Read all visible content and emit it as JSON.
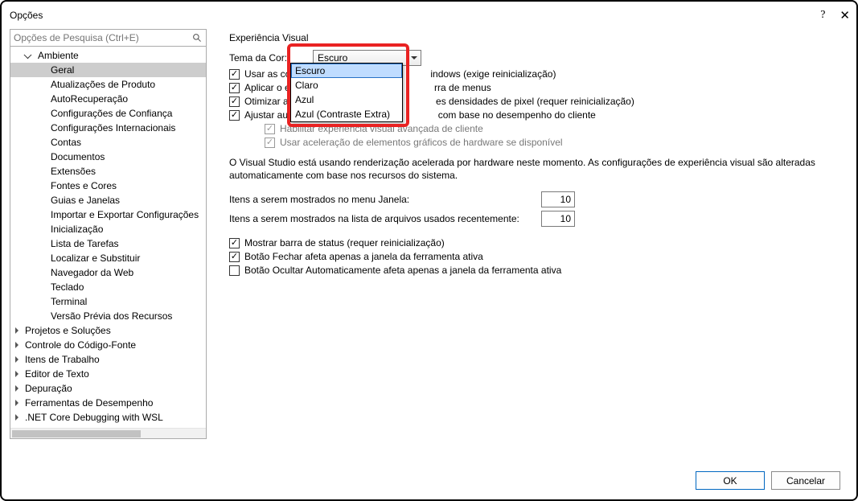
{
  "window": {
    "title": "Opções"
  },
  "search": {
    "placeholder": "Opções de Pesquisa (Ctrl+E)"
  },
  "tree": {
    "ambiente": "Ambiente",
    "geral": "Geral",
    "atualizacoes": "Atualizações de Produto",
    "autorecup": "AutoRecuperação",
    "confianca": "Configurações de Confiança",
    "internacionais": "Configurações Internacionais",
    "contas": "Contas",
    "documentos": "Documentos",
    "extensoes": "Extensões",
    "fontescores": "Fontes e Cores",
    "guiasjanelas": "Guias e Janelas",
    "importarexportar": "Importar e Exportar Configurações",
    "inicializacao": "Inicialização",
    "listatarefas": "Lista de Tarefas",
    "localizar": "Localizar e Substituir",
    "navegador": "Navegador da Web",
    "teclado": "Teclado",
    "terminal": "Terminal",
    "versaoprevia": "Versão Prévia dos Recursos",
    "projetos": "Projetos e Soluções",
    "codigofonte": "Controle do Código-Fonte",
    "itenstrabalho": "Itens de Trabalho",
    "editortexto": "Editor de Texto",
    "depuracao": "Depuração",
    "ferramentasdesemp": "Ferramentas de Desempenho",
    "netcoredbg": ".NET Core Debugging with WSL"
  },
  "content": {
    "section_title": "Experiência Visual",
    "theme_label": "Tema da Cor:",
    "theme_value": "Escuro",
    "theme_options": {
      "escuro": "Escuro",
      "claro": "Claro",
      "azul": "Azul",
      "azulextra": "Azul (Contraste Extra)"
    },
    "chk_usar": "Usar as configurações do Windows (exige reinicialização)",
    "chk_usar_partial": "Usar as configu",
    "chk_usar_suffix": "indows (exige reinicialização)",
    "chk_aplicar": "Aplicar o estilo",
    "chk_aplicar_suffix": "rra de menus",
    "chk_otimizar": "Otimizar a rend",
    "chk_otimizar_suffix": "es densidades de pixel (requer reinicialização)",
    "chk_ajustar": "Ajustar automa",
    "chk_ajustar_suffix": " com base no desempenho do cliente",
    "chk_habilitar": "Habilitar experiência visual avançada de cliente",
    "chk_aceleracao": "Usar aceleração de elementos gráficos de hardware se disponível",
    "infotext": "O Visual Studio está usando renderização acelerada por hardware neste momento. As configurações de experiência visual são alteradas automaticamente com base nos recursos do sistema.",
    "itens_janela_label": "Itens a serem mostrados no menu Janela:",
    "itens_janela_value": "10",
    "itens_recentes_label": "Itens a serem mostrados na lista de arquivos usados recentemente:",
    "itens_recentes_value": "10",
    "chk_status": "Mostrar barra de status (requer reinicialização)",
    "chk_fechar": "Botão Fechar afeta apenas a janela da ferramenta ativa",
    "chk_ocultar": "Botão Ocultar Automaticamente afeta apenas a janela da ferramenta ativa"
  },
  "footer": {
    "ok": "OK",
    "cancel": "Cancelar"
  }
}
